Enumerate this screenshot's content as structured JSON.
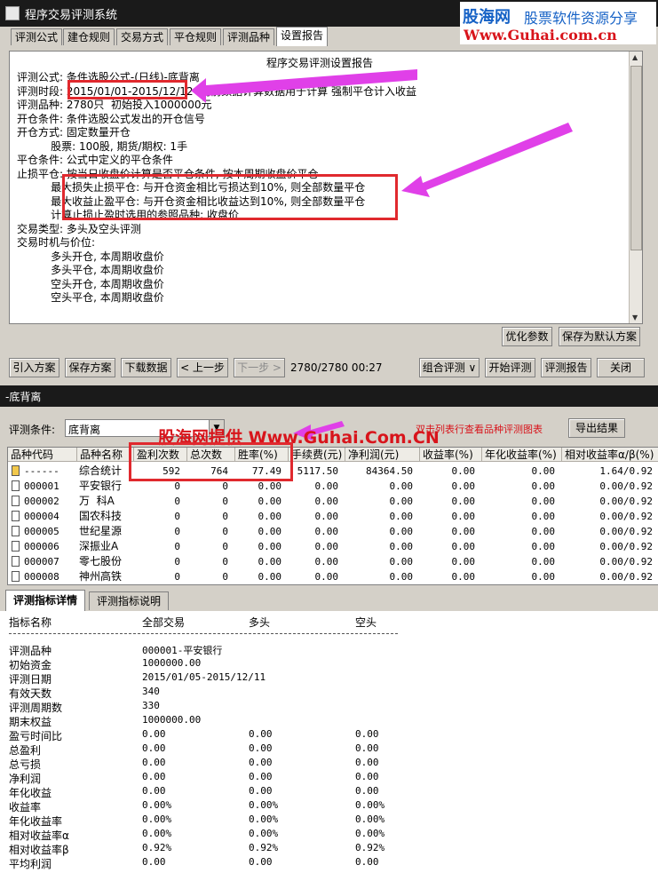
{
  "window": {
    "title": "程序交易评测系统"
  },
  "watermark": {
    "logo_cn": "股海网",
    "slogan": "股票软件资源分享",
    "url": "Www.Guhai.com.cn",
    "overlay_text": "股海网提供 Www.Guhai.Com.CN"
  },
  "tabs": [
    "评测公式",
    "建仓规则",
    "交易方式",
    "平仓规则",
    "评测品种",
    "设置报告"
  ],
  "report": {
    "title": "程序交易评测设置报告",
    "lines": [
      "评测公式: 条件选股公式-(日线)-底背离",
      "评测时段: 2015/01/01-2015/12/12  向前数据计算数据用于计算 强制平仓计入收益",
      "评测品种: 2780只  初始投入1000000元",
      "开仓条件: 条件选股公式发出的开仓信号",
      "开仓方式: 固定数量开仓",
      "          股票: 100股, 期货/期权: 1手",
      "平仓条件: 公式中定义的平仓条件",
      "止损平仓: 按当日收盘价计算是否平仓条件, 按本周期收盘价平仓",
      "          最大损失止损平仓: 与开仓资金相比亏损达到10%, 则全部数量平仓",
      "          最大收益止盈平仓: 与开仓资金相比收益达到10%, 则全部数量平仓",
      "          计算止损止盈时选用的参照品种: 收盘价",
      "",
      "交易类型: 多头及空头评测",
      "交易时机与价位:",
      "          多头开仓, 本周期收盘价",
      "          多头平仓, 本周期收盘价",
      "          空头开仓, 本周期收盘价",
      "          空头平仓, 本周期收盘价"
    ]
  },
  "buttons_top": {
    "optimize": "优化参数",
    "save_default": "保存为默认方案"
  },
  "buttons_bar": {
    "import": "引入方案",
    "save": "保存方案",
    "download": "下载数据",
    "prev": "< 上一步",
    "next": "下一步 >",
    "progress": "2780/2780 00:27",
    "combo_eval": "组合评测",
    "start": "开始评测",
    "report": "评测报告",
    "close": "关闭"
  },
  "window2": {
    "title": "-底背离"
  },
  "eval_condition": {
    "label": "评测条件:",
    "value": "底背离",
    "hint": "双击列表行查看品种评测图表",
    "export": "导出结果"
  },
  "grid": {
    "columns": [
      "品种代码",
      "品种名称",
      "盈利次数",
      "总次数",
      "胜率(%)",
      "手续费(元)",
      "净利润(元)",
      "收益率(%)",
      "年化收益率(%)",
      "相对收益率α/β(%)"
    ],
    "rows": [
      [
        "------",
        "综合统计",
        "592",
        "764",
        "77.49",
        "5117.50",
        "84364.50",
        "0.00",
        "0.00",
        "1.64/0.92"
      ],
      [
        "000001",
        "平安银行",
        "0",
        "0",
        "0.00",
        "0.00",
        "0.00",
        "0.00",
        "0.00",
        "0.00/0.92"
      ],
      [
        "000002",
        "万  科A",
        "0",
        "0",
        "0.00",
        "0.00",
        "0.00",
        "0.00",
        "0.00",
        "0.00/0.92"
      ],
      [
        "000004",
        "国农科技",
        "0",
        "0",
        "0.00",
        "0.00",
        "0.00",
        "0.00",
        "0.00",
        "0.00/0.92"
      ],
      [
        "000005",
        "世纪星源",
        "0",
        "0",
        "0.00",
        "0.00",
        "0.00",
        "0.00",
        "0.00",
        "0.00/0.92"
      ],
      [
        "000006",
        "深振业A",
        "0",
        "0",
        "0.00",
        "0.00",
        "0.00",
        "0.00",
        "0.00",
        "0.00/0.92"
      ],
      [
        "000007",
        "零七股份",
        "0",
        "0",
        "0.00",
        "0.00",
        "0.00",
        "0.00",
        "0.00",
        "0.00/0.92"
      ],
      [
        "000008",
        "神州高铁",
        "0",
        "0",
        "0.00",
        "0.00",
        "0.00",
        "0.00",
        "0.00",
        "0.00/0.92"
      ]
    ]
  },
  "bottom_tabs": [
    "评测指标详情",
    "评测指标说明"
  ],
  "details": {
    "headers": [
      "指标名称",
      "全部交易",
      "多头",
      "空头"
    ],
    "rows": [
      [
        "评测品种",
        "000001-平安银行",
        "",
        ""
      ],
      [
        "初始资金",
        "1000000.00",
        "",
        ""
      ],
      [
        "评测日期",
        "2015/01/05-2015/12/11",
        "",
        ""
      ],
      [
        "有效天数",
        "340",
        "",
        ""
      ],
      [
        "评测周期数",
        "330",
        "",
        ""
      ],
      [
        "期末权益",
        "1000000.00",
        "",
        ""
      ],
      [
        "盈亏时间比",
        "0.00",
        "0.00",
        "0.00"
      ],
      [
        "总盈利",
        "0.00",
        "0.00",
        "0.00"
      ],
      [
        "总亏损",
        "0.00",
        "0.00",
        "0.00"
      ],
      [
        "净利润",
        "0.00",
        "0.00",
        "0.00"
      ],
      [
        "年化收益",
        "0.00",
        "0.00",
        "0.00"
      ],
      [
        "收益率",
        "0.00%",
        "0.00%",
        "0.00%"
      ],
      [
        "年化收益率",
        "0.00%",
        "0.00%",
        "0.00%"
      ],
      [
        "相对收益率α",
        "0.00%",
        "0.00%",
        "0.00%"
      ],
      [
        "相对收益率β",
        "0.92%",
        "0.92%",
        "0.92%"
      ],
      [
        "平均利润",
        "0.00",
        "0.00",
        "0.00"
      ]
    ]
  },
  "colors": {
    "highlight_red": "#e0292e",
    "arrow_magenta": "#e040e8",
    "watermark_red": "#d8141b",
    "watermark_blue": "#1662c6"
  }
}
